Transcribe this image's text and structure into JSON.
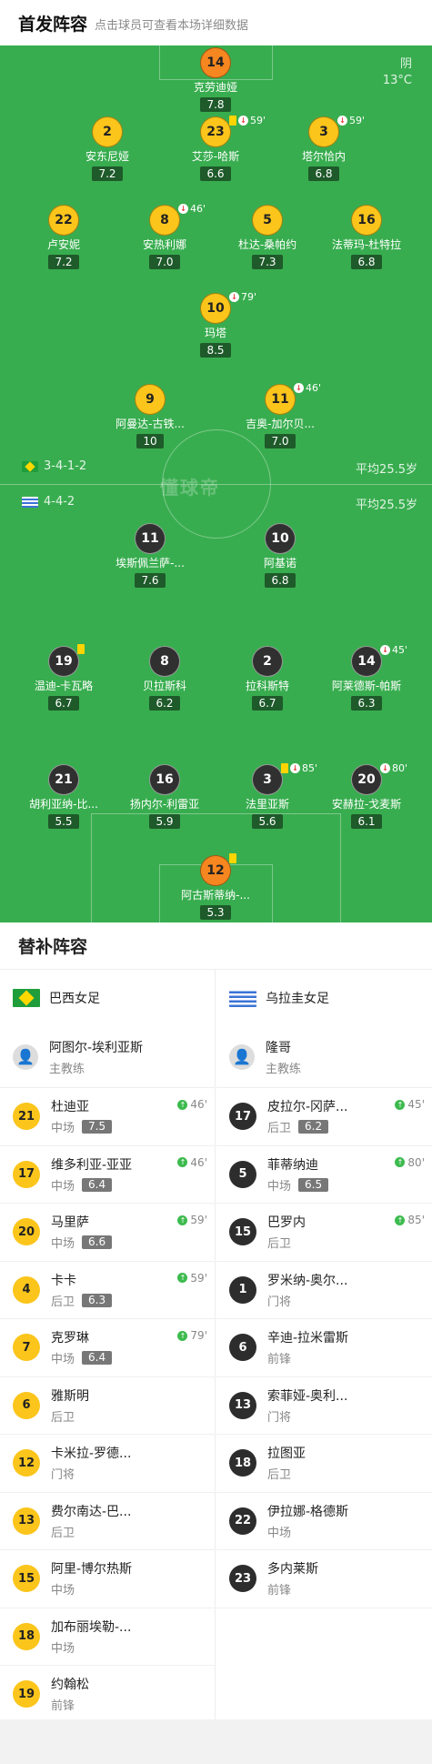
{
  "header": {
    "title": "首发阵容",
    "subtitle": "点击球员可查看本场详细数据"
  },
  "weather": {
    "cond": "阴",
    "temp": "13°C"
  },
  "watermark": "懂球帝",
  "home": {
    "formation": "3-4-1-2",
    "avg": "平均25.5岁",
    "flag": "brazil-flag"
  },
  "away": {
    "formation": "4-4-2",
    "avg": "平均25.5岁",
    "flag": "uruguay-flag"
  },
  "lineup": [
    {
      "num": "14",
      "name": "克劳迪娅",
      "rating": "7.8",
      "side": "gk",
      "events": ""
    },
    {
      "num": "2",
      "name": "安东尼娅",
      "rating": "7.2",
      "side": "home",
      "events": ""
    },
    {
      "num": "23",
      "name": "艾莎-哈斯",
      "rating": "6.6",
      "side": "home",
      "events": "59'"
    },
    {
      "num": "3",
      "name": "塔尔恰内",
      "rating": "6.8",
      "side": "home",
      "events": "59'"
    },
    {
      "num": "22",
      "name": "卢安妮",
      "rating": "7.2",
      "side": "home",
      "events": ""
    },
    {
      "num": "8",
      "name": "安热利娜",
      "rating": "7.0",
      "side": "home",
      "events": "46'"
    },
    {
      "num": "5",
      "name": "杜达-桑帕约",
      "rating": "7.3",
      "side": "home",
      "events": ""
    },
    {
      "num": "16",
      "name": "法蒂玛-杜特拉",
      "rating": "6.8",
      "side": "home",
      "events": ""
    },
    {
      "num": "10",
      "name": "玛塔",
      "rating": "8.5",
      "side": "home",
      "events": "79'"
    },
    {
      "num": "9",
      "name": "阿曼达-古铁...",
      "rating": "10",
      "side": "home",
      "events": ""
    },
    {
      "num": "11",
      "name": "吉奥-加尔贝...",
      "rating": "7.0",
      "side": "home",
      "events": "46'"
    },
    {
      "num": "11",
      "name": "埃斯佩兰萨-...",
      "rating": "7.6",
      "side": "away",
      "events": ""
    },
    {
      "num": "10",
      "name": "阿基诺",
      "rating": "6.8",
      "side": "away",
      "events": ""
    },
    {
      "num": "19",
      "name": "温迪-卡瓦略",
      "rating": "6.7",
      "side": "away",
      "events": ""
    },
    {
      "num": "8",
      "name": "贝拉斯科",
      "rating": "6.2",
      "side": "away",
      "events": ""
    },
    {
      "num": "2",
      "name": "拉科斯特",
      "rating": "6.7",
      "side": "away",
      "events": ""
    },
    {
      "num": "14",
      "name": "阿莱德斯-帕斯",
      "rating": "6.3",
      "side": "away",
      "events": "45'"
    },
    {
      "num": "21",
      "name": "胡利亚纳-比...",
      "rating": "5.5",
      "side": "away",
      "events": ""
    },
    {
      "num": "16",
      "name": "扬内尔-利雷亚",
      "rating": "5.9",
      "side": "away",
      "events": ""
    },
    {
      "num": "3",
      "name": "法里亚斯",
      "rating": "5.6",
      "side": "away",
      "events": "85'"
    },
    {
      "num": "20",
      "name": "安赫拉-戈麦斯",
      "rating": "6.1",
      "side": "away",
      "events": "80'"
    },
    {
      "num": "12",
      "name": "阿古斯蒂纳-...",
      "rating": "5.3",
      "side": "gk",
      "events": ""
    }
  ],
  "subs_title": "替补阵容",
  "home_team": {
    "name": "巴西女足",
    "coach": "阿图尔-埃利亚斯",
    "role": "主教练"
  },
  "away_team": {
    "name": "乌拉圭女足",
    "coach": "隆哥",
    "role": "主教练"
  },
  "home_subs": [
    {
      "num": "21",
      "name": "杜迪亚",
      "pos": "中场",
      "rating": "7.5",
      "events": "46'"
    },
    {
      "num": "17",
      "name": "维多利亚-亚亚",
      "pos": "中场",
      "rating": "6.4",
      "events": "46'"
    },
    {
      "num": "20",
      "name": "马里萨",
      "pos": "中场",
      "rating": "6.6",
      "events": "59'"
    },
    {
      "num": "4",
      "name": "卡卡",
      "pos": "后卫",
      "rating": "6.3",
      "events": "59'"
    },
    {
      "num": "7",
      "name": "克罗琳",
      "pos": "中场",
      "rating": "6.4",
      "events": "79'"
    },
    {
      "num": "6",
      "name": "雅斯明",
      "pos": "后卫",
      "rating": "",
      "events": ""
    },
    {
      "num": "12",
      "name": "卡米拉-罗德...",
      "pos": "门将",
      "rating": "",
      "events": ""
    },
    {
      "num": "13",
      "name": "费尔南达-巴...",
      "pos": "后卫",
      "rating": "",
      "events": ""
    },
    {
      "num": "15",
      "name": "阿里-博尔热斯",
      "pos": "中场",
      "rating": "",
      "events": ""
    },
    {
      "num": "18",
      "name": "加布丽埃勒-...",
      "pos": "中场",
      "rating": "",
      "events": ""
    },
    {
      "num": "19",
      "name": "约翰松",
      "pos": "前锋",
      "rating": "",
      "events": ""
    }
  ],
  "away_subs": [
    {
      "num": "17",
      "name": "皮拉尔-冈萨...",
      "pos": "后卫",
      "rating": "6.2",
      "events": "45'"
    },
    {
      "num": "5",
      "name": "菲蒂纳迪",
      "pos": "中场",
      "rating": "6.5",
      "events": "80'"
    },
    {
      "num": "15",
      "name": "巴罗内",
      "pos": "后卫",
      "rating": "",
      "events": "85'"
    },
    {
      "num": "1",
      "name": "罗米纳-奥尔...",
      "pos": "门将",
      "rating": "",
      "events": ""
    },
    {
      "num": "6",
      "name": "辛迪-拉米雷斯",
      "pos": "前锋",
      "rating": "",
      "events": ""
    },
    {
      "num": "13",
      "name": "索菲娅-奥利...",
      "pos": "门将",
      "rating": "",
      "events": ""
    },
    {
      "num": "18",
      "name": "拉图亚",
      "pos": "后卫",
      "rating": "",
      "events": ""
    },
    {
      "num": "22",
      "name": "伊拉娜-格德斯",
      "pos": "中场",
      "rating": "",
      "events": ""
    },
    {
      "num": "23",
      "name": "多内莱斯",
      "pos": "前锋",
      "rating": "",
      "events": ""
    }
  ]
}
